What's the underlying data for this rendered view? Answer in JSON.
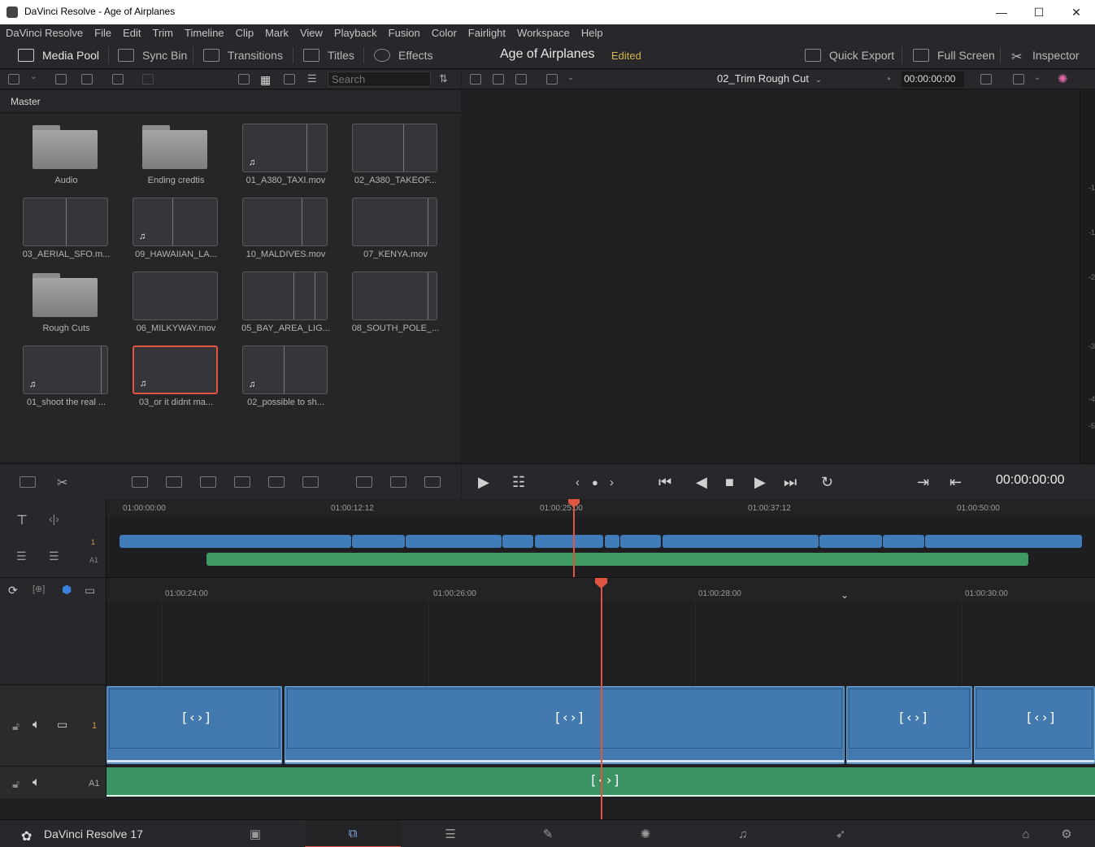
{
  "window": {
    "title": "DaVinci Resolve - Age of Airplanes"
  },
  "menu": [
    "DaVinci Resolve",
    "File",
    "Edit",
    "Trim",
    "Timeline",
    "Clip",
    "Mark",
    "View",
    "Playback",
    "Fusion",
    "Color",
    "Fairlight",
    "Workspace",
    "Help"
  ],
  "toolbar": {
    "media_pool": "Media Pool",
    "sync_bin": "Sync Bin",
    "transitions": "Transitions",
    "titles": "Titles",
    "effects": "Effects",
    "project_title": "Age of Airplanes",
    "project_status": "Edited",
    "quick_export": "Quick Export",
    "full_screen": "Full Screen",
    "inspector": "Inspector"
  },
  "media_pool": {
    "search_placeholder": "Search",
    "bin": "Master",
    "items": [
      {
        "label": "Audio",
        "type": "folder"
      },
      {
        "label": "Ending credtis",
        "type": "folder"
      },
      {
        "label": "01_A380_TAXI.mov",
        "type": "clip",
        "audio": true
      },
      {
        "label": "02_A380_TAKEOF...",
        "type": "clip",
        "audio": false
      },
      {
        "label": "03_AERIAL_SFO.m...",
        "type": "clip",
        "audio": false
      },
      {
        "label": "09_HAWAIIAN_LA...",
        "type": "clip",
        "audio": true
      },
      {
        "label": "10_MALDIVES.mov",
        "type": "clip",
        "audio": false
      },
      {
        "label": "07_KENYA.mov",
        "type": "clip",
        "audio": false
      },
      {
        "label": "Rough Cuts",
        "type": "folder"
      },
      {
        "label": "06_MILKYWAY.mov",
        "type": "clip",
        "audio": false
      },
      {
        "label": "05_BAY_AREA_LIG...",
        "type": "clip",
        "audio": false
      },
      {
        "label": "08_SOUTH_POLE_...",
        "type": "clip",
        "audio": false
      },
      {
        "label": "01_shoot the real ...",
        "type": "clip",
        "audio": true
      },
      {
        "label": "03_or it didnt ma...",
        "type": "clip",
        "audio": true,
        "selected": true
      },
      {
        "label": "02_possible to sh...",
        "type": "clip",
        "audio": true
      }
    ]
  },
  "viewer": {
    "timeline_name": "02_Trim Rough Cut",
    "timecode": "00:00:00:00",
    "transport_timecode": "00:00:00:00",
    "meter_ticks": [
      "-1",
      "-1",
      "-2",
      "-3",
      "-4",
      "-5"
    ]
  },
  "upper_timeline": {
    "ruler": [
      "01:00:00:00",
      "01:00:12:12",
      "01:00:25:00",
      "01:00:37:12",
      "01:00:50:00"
    ],
    "video_track": "1",
    "audio_track": "A1"
  },
  "lower_timeline": {
    "ruler": [
      "01:00:24:00",
      "01:00:26:00",
      "01:00:28:00",
      "01:00:30:00"
    ],
    "video_track": "1",
    "audio_track": "A1",
    "clip_glyph": "[‹›]"
  },
  "pagenav": {
    "brand": "DaVinci Resolve 17"
  },
  "colors": {
    "accent": "#e0553f",
    "video": "#4279ae",
    "audio": "#3b9363",
    "edited": "#d4b84a"
  }
}
